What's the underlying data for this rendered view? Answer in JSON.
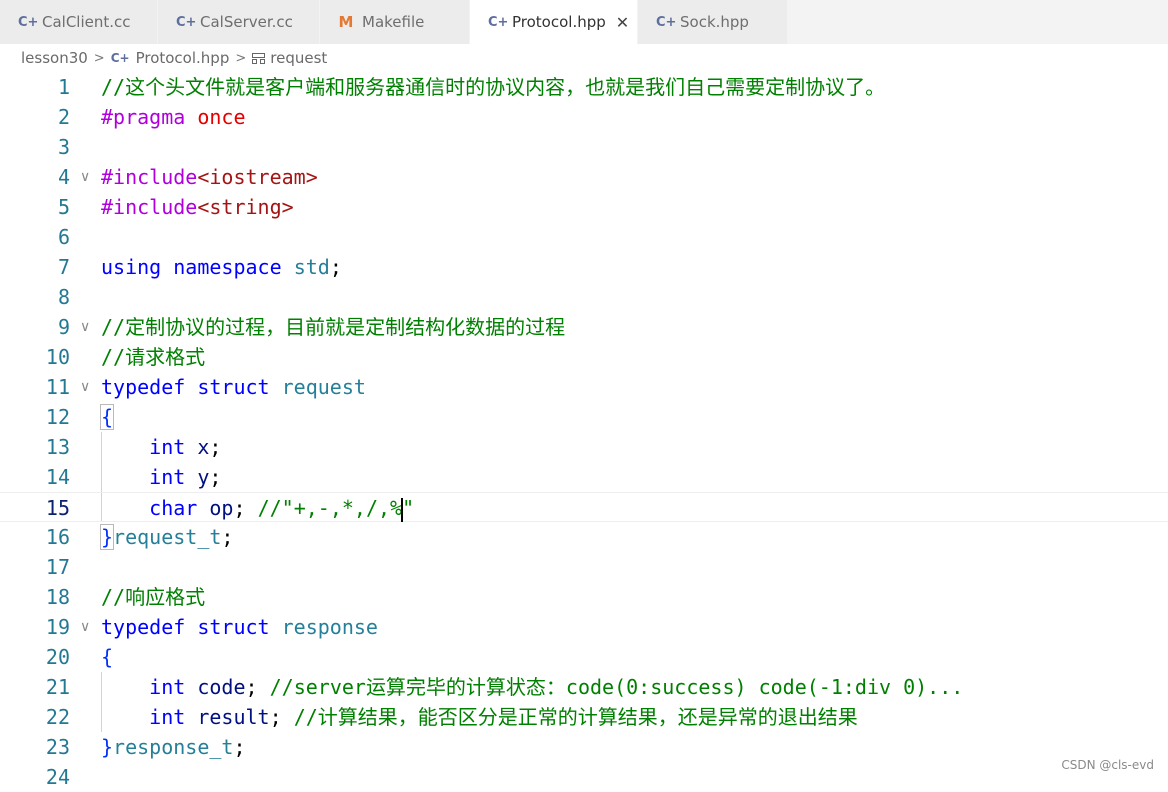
{
  "tabs": [
    {
      "label": "CalClient.cc",
      "icon": "cpp-file-icon",
      "active": false
    },
    {
      "label": "CalServer.cc",
      "icon": "cpp-file-icon",
      "active": false
    },
    {
      "label": "Makefile",
      "icon": "makefile-icon",
      "active": false
    },
    {
      "label": "Protocol.hpp",
      "icon": "cpp-file-icon",
      "active": true
    },
    {
      "label": "Sock.hpp",
      "icon": "cpp-file-icon",
      "active": false
    }
  ],
  "breadcrumb": {
    "folder": "lesson30",
    "file": "Protocol.hpp",
    "symbol": "request"
  },
  "lines": [
    {
      "n": "1",
      "text": "//这个头文件就是客户端和服务器通信时的协议内容，也就是我们自己需要定制协议了。"
    },
    {
      "n": "2",
      "text": "#pragma once"
    },
    {
      "n": "3",
      "text": ""
    },
    {
      "n": "4",
      "text": "#include<iostream>"
    },
    {
      "n": "5",
      "text": "#include<string>"
    },
    {
      "n": "6",
      "text": ""
    },
    {
      "n": "7",
      "text": "using namespace std;"
    },
    {
      "n": "8",
      "text": ""
    },
    {
      "n": "9",
      "text": "//定制协议的过程，目前就是定制结构化数据的过程"
    },
    {
      "n": "10",
      "text": "//请求格式"
    },
    {
      "n": "11",
      "text": "typedef struct request"
    },
    {
      "n": "12",
      "text": "{"
    },
    {
      "n": "13",
      "text": "    int x;"
    },
    {
      "n": "14",
      "text": "    int y;"
    },
    {
      "n": "15",
      "text": "    char op; //\"+,-,*,/,%\""
    },
    {
      "n": "16",
      "text": "}request_t;"
    },
    {
      "n": "17",
      "text": ""
    },
    {
      "n": "18",
      "text": "//响应格式"
    },
    {
      "n": "19",
      "text": "typedef struct response"
    },
    {
      "n": "20",
      "text": "{"
    },
    {
      "n": "21",
      "text": "    int code; //server运算完毕的计算状态：code(0:success) code(-1:div 0)..."
    },
    {
      "n": "22",
      "text": "    int result; //计算结果，能否区分是正常的计算结果，还是异常的退出结果"
    },
    {
      "n": "23",
      "text": "}response_t;"
    },
    {
      "n": "24",
      "text": ""
    }
  ],
  "current_line": "15",
  "watermark": "CSDN @cls-evd",
  "colors": {
    "comment": "#008000",
    "preprocessor": "#af00db",
    "keyword": "#0000ff",
    "type": "#267f99",
    "variable": "#001080",
    "line_number": "#237893",
    "active_tab_bg": "#ffffff",
    "tabbar_bg": "#f3f3f3"
  }
}
